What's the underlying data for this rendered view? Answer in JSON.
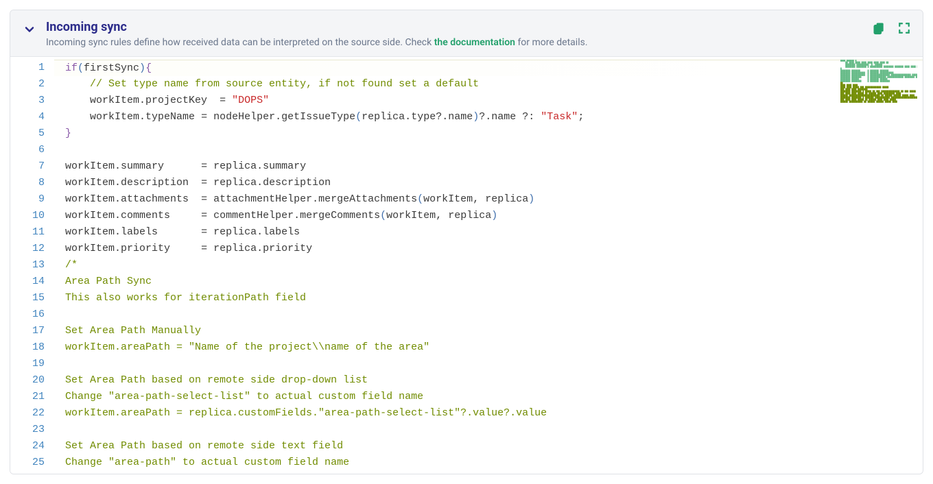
{
  "header": {
    "title": "Incoming sync",
    "subtitle_pre": "Incoming sync rules define how received data can be interpreted on the source side. Check ",
    "doc_link": "the documentation",
    "subtitle_post": " for more details."
  },
  "editor": {
    "lines": [
      {
        "n": 1,
        "hl": true,
        "tokens": [
          [
            "kw",
            "if"
          ],
          [
            "paren",
            "("
          ],
          [
            "prop",
            "firstSync"
          ],
          [
            "paren",
            ")"
          ],
          [
            "brace",
            "{"
          ]
        ]
      },
      {
        "n": 2,
        "indent": "    ",
        "tokens": [
          [
            "com",
            "// Set type name from source entity, if not found set a default"
          ]
        ]
      },
      {
        "n": 3,
        "indent": "    ",
        "tokens": [
          [
            "prop",
            "workItem"
          ],
          [
            "punc",
            "."
          ],
          [
            "prop",
            "projectKey  "
          ],
          [
            "punc",
            "= "
          ],
          [
            "str",
            "\"DOPS\""
          ]
        ]
      },
      {
        "n": 4,
        "indent": "    ",
        "tokens": [
          [
            "prop",
            "workItem"
          ],
          [
            "punc",
            "."
          ],
          [
            "prop",
            "typeName "
          ],
          [
            "punc",
            "= "
          ],
          [
            "prop",
            "nodeHelper"
          ],
          [
            "punc",
            "."
          ],
          [
            "prop",
            "getIssueType"
          ],
          [
            "paren",
            "("
          ],
          [
            "prop",
            "replica"
          ],
          [
            "punc",
            "."
          ],
          [
            "prop",
            "type"
          ],
          [
            "punc",
            "?."
          ],
          [
            "prop",
            "name"
          ],
          [
            "paren",
            ")"
          ],
          [
            "punc",
            "?."
          ],
          [
            "prop",
            "name "
          ],
          [
            "punc",
            "?: "
          ],
          [
            "str",
            "\"Task\""
          ],
          [
            "punc",
            ";"
          ]
        ]
      },
      {
        "n": 5,
        "tokens": [
          [
            "brace",
            "}"
          ]
        ]
      },
      {
        "n": 6,
        "tokens": []
      },
      {
        "n": 7,
        "tokens": [
          [
            "prop",
            "workItem"
          ],
          [
            "punc",
            "."
          ],
          [
            "prop",
            "summary      "
          ],
          [
            "punc",
            "= "
          ],
          [
            "prop",
            "replica"
          ],
          [
            "punc",
            "."
          ],
          [
            "prop",
            "summary"
          ]
        ]
      },
      {
        "n": 8,
        "tokens": [
          [
            "prop",
            "workItem"
          ],
          [
            "punc",
            "."
          ],
          [
            "prop",
            "description  "
          ],
          [
            "punc",
            "= "
          ],
          [
            "prop",
            "replica"
          ],
          [
            "punc",
            "."
          ],
          [
            "prop",
            "description"
          ]
        ]
      },
      {
        "n": 9,
        "tokens": [
          [
            "prop",
            "workItem"
          ],
          [
            "punc",
            "."
          ],
          [
            "prop",
            "attachments  "
          ],
          [
            "punc",
            "= "
          ],
          [
            "prop",
            "attachmentHelper"
          ],
          [
            "punc",
            "."
          ],
          [
            "prop",
            "mergeAttachments"
          ],
          [
            "paren",
            "("
          ],
          [
            "prop",
            "workItem"
          ],
          [
            "punc",
            ", "
          ],
          [
            "prop",
            "replica"
          ],
          [
            "paren",
            ")"
          ]
        ]
      },
      {
        "n": 10,
        "tokens": [
          [
            "prop",
            "workItem"
          ],
          [
            "punc",
            "."
          ],
          [
            "prop",
            "comments     "
          ],
          [
            "punc",
            "= "
          ],
          [
            "prop",
            "commentHelper"
          ],
          [
            "punc",
            "."
          ],
          [
            "prop",
            "mergeComments"
          ],
          [
            "paren",
            "("
          ],
          [
            "prop",
            "workItem"
          ],
          [
            "punc",
            ", "
          ],
          [
            "prop",
            "replica"
          ],
          [
            "paren",
            ")"
          ]
        ]
      },
      {
        "n": 11,
        "tokens": [
          [
            "prop",
            "workItem"
          ],
          [
            "punc",
            "."
          ],
          [
            "prop",
            "labels       "
          ],
          [
            "punc",
            "= "
          ],
          [
            "prop",
            "replica"
          ],
          [
            "punc",
            "."
          ],
          [
            "prop",
            "labels"
          ]
        ]
      },
      {
        "n": 12,
        "tokens": [
          [
            "prop",
            "workItem"
          ],
          [
            "punc",
            "."
          ],
          [
            "prop",
            "priority     "
          ],
          [
            "punc",
            "= "
          ],
          [
            "prop",
            "replica"
          ],
          [
            "punc",
            "."
          ],
          [
            "prop",
            "priority"
          ]
        ]
      },
      {
        "n": 13,
        "tokens": [
          [
            "com",
            "/*"
          ]
        ]
      },
      {
        "n": 14,
        "tokens": [
          [
            "com",
            "Area Path Sync"
          ]
        ]
      },
      {
        "n": 15,
        "tokens": [
          [
            "com",
            "This also works for iterationPath field"
          ]
        ]
      },
      {
        "n": 16,
        "tokens": []
      },
      {
        "n": 17,
        "tokens": [
          [
            "com",
            "Set Area Path Manually"
          ]
        ]
      },
      {
        "n": 18,
        "tokens": [
          [
            "com",
            "workItem.areaPath = \"Name of the project\\\\name of the area\""
          ]
        ]
      },
      {
        "n": 19,
        "tokens": []
      },
      {
        "n": 20,
        "tokens": [
          [
            "com",
            "Set Area Path based on remote side drop-down list"
          ]
        ]
      },
      {
        "n": 21,
        "tokens": [
          [
            "com",
            "Change \"area-path-select-list\" to actual custom field name"
          ]
        ]
      },
      {
        "n": 22,
        "tokens": [
          [
            "com",
            "workItem.areaPath = replica.customFields.\"area-path-select-list\"?.value?.value"
          ]
        ]
      },
      {
        "n": 23,
        "tokens": []
      },
      {
        "n": 24,
        "tokens": [
          [
            "com",
            "Set Area Path based on remote side text field"
          ]
        ]
      },
      {
        "n": 25,
        "tokens": [
          [
            "com",
            "Change \"area-path\" to actual custom field name"
          ]
        ]
      }
    ]
  },
  "minimap": [
    "████ ██████ █",
    "    ██ ████ ████ ████ ████ ████ ████ ██",
    "    ████████ ██████████  █  ██████",
    "    ████████ ████████ █ ██████████ ████████ ███████ ████ ████ ████ ████ █ ██████",
    "█",
    "",
    "████████ ███████      █ ███████ ███████",
    "████████ ███████████  █ ███████ ███████████",
    "████████ ███████████  █ ████████████████ ████████████████ ████████ ███████",
    "████████ ████████     █ █████████████ █████████████ ████████ ███████",
    "████████ ██████       █ ███████ ██████",
    "████████ ████████     █ ███████ ████████",
    "██",
    "████ ████ ████",
    "████ ████ █████ ███ █████████████ █████",
    "",
    "███ ████ ████ ████████",
    "████████ ████████ █ █████ ██ ███ ███████████████ ██ ███ █████",
    "",
    "███ ████ ████ █████ ██ ██████ ████ █████████ ████",
    "██████ █████████████████████████ ██ ██████ ██████ █████ ████",
    "████████ ████████ █ ███████ ████████████ █████████████████████████ ██████ ██████",
    "",
    "███ ████ ████ █████ ██ ██████ ████ ████ █████",
    "██████ ███████████ ██ ██████ ██████ █████ ████"
  ]
}
